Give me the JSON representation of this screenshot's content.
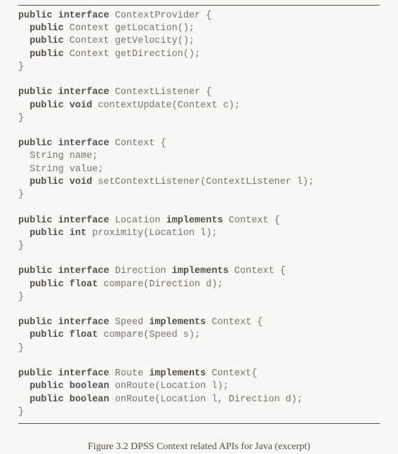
{
  "caption": "Figure 3.2 DPSS Context related APIs for Java (excerpt)",
  "code": {
    "lines": [
      [
        [
          "kw",
          "public"
        ],
        [
          "sp",
          " "
        ],
        [
          "kw",
          "interface"
        ],
        [
          "sp",
          " "
        ],
        [
          "id",
          "ContextProvider "
        ],
        [
          "pn",
          "{"
        ]
      ],
      [
        [
          "sp",
          "  "
        ],
        [
          "kw",
          "public"
        ],
        [
          "sp",
          " "
        ],
        [
          "id",
          "Context getLocation"
        ],
        [
          "pn",
          "();"
        ]
      ],
      [
        [
          "sp",
          "  "
        ],
        [
          "kw",
          "public"
        ],
        [
          "sp",
          " "
        ],
        [
          "id",
          "Context getVelocity"
        ],
        [
          "pn",
          "();"
        ]
      ],
      [
        [
          "sp",
          "  "
        ],
        [
          "kw",
          "public"
        ],
        [
          "sp",
          " "
        ],
        [
          "id",
          "Context getDirection"
        ],
        [
          "pn",
          "();"
        ]
      ],
      [
        [
          "pn",
          "}"
        ]
      ],
      "blank",
      [
        [
          "kw",
          "public"
        ],
        [
          "sp",
          " "
        ],
        [
          "kw",
          "interface"
        ],
        [
          "sp",
          " "
        ],
        [
          "id",
          "ContextListener "
        ],
        [
          "pn",
          "{"
        ]
      ],
      [
        [
          "sp",
          "  "
        ],
        [
          "kw",
          "public"
        ],
        [
          "sp",
          " "
        ],
        [
          "kw",
          "void"
        ],
        [
          "sp",
          " "
        ],
        [
          "id",
          "contextUpdate"
        ],
        [
          "pn",
          "("
        ],
        [
          "id",
          "Context c"
        ],
        [
          "pn",
          ");"
        ]
      ],
      [
        [
          "pn",
          "}"
        ]
      ],
      "blank",
      [
        [
          "kw",
          "public"
        ],
        [
          "sp",
          " "
        ],
        [
          "kw",
          "interface"
        ],
        [
          "sp",
          " "
        ],
        [
          "id",
          "Context "
        ],
        [
          "pn",
          "{"
        ]
      ],
      [
        [
          "sp",
          "  "
        ],
        [
          "id",
          "String name"
        ],
        [
          "pn",
          ";"
        ]
      ],
      [
        [
          "sp",
          "  "
        ],
        [
          "id",
          "String value"
        ],
        [
          "pn",
          ";"
        ]
      ],
      [
        [
          "sp",
          "  "
        ],
        [
          "kw",
          "public"
        ],
        [
          "sp",
          " "
        ],
        [
          "kw",
          "void"
        ],
        [
          "sp",
          " "
        ],
        [
          "id",
          "setContextListener"
        ],
        [
          "pn",
          "("
        ],
        [
          "id",
          "ContextListener l"
        ],
        [
          "pn",
          ");"
        ]
      ],
      [
        [
          "pn",
          "}"
        ]
      ],
      "blank",
      [
        [
          "kw",
          "public"
        ],
        [
          "sp",
          " "
        ],
        [
          "kw",
          "interface"
        ],
        [
          "sp",
          " "
        ],
        [
          "id",
          "Location "
        ],
        [
          "kw",
          "implements"
        ],
        [
          "sp",
          " "
        ],
        [
          "id",
          "Context "
        ],
        [
          "pn",
          "{"
        ]
      ],
      [
        [
          "sp",
          "  "
        ],
        [
          "kw",
          "public"
        ],
        [
          "sp",
          " "
        ],
        [
          "kw",
          "int"
        ],
        [
          "sp",
          " "
        ],
        [
          "id",
          "proximity"
        ],
        [
          "pn",
          "("
        ],
        [
          "id",
          "Location l"
        ],
        [
          "pn",
          ");"
        ]
      ],
      [
        [
          "pn",
          "}"
        ]
      ],
      "blank",
      [
        [
          "kw",
          "public"
        ],
        [
          "sp",
          " "
        ],
        [
          "kw",
          "interface"
        ],
        [
          "sp",
          " "
        ],
        [
          "id",
          "Direction "
        ],
        [
          "kw",
          "implements"
        ],
        [
          "sp",
          " "
        ],
        [
          "id",
          "Context "
        ],
        [
          "pn",
          "{"
        ]
      ],
      [
        [
          "sp",
          "  "
        ],
        [
          "kw",
          "public"
        ],
        [
          "sp",
          " "
        ],
        [
          "kw",
          "float"
        ],
        [
          "sp",
          " "
        ],
        [
          "id",
          "compare"
        ],
        [
          "pn",
          "("
        ],
        [
          "id",
          "Direction d"
        ],
        [
          "pn",
          ");"
        ]
      ],
      [
        [
          "pn",
          "}"
        ]
      ],
      "blank",
      [
        [
          "kw",
          "public"
        ],
        [
          "sp",
          " "
        ],
        [
          "kw",
          "interface"
        ],
        [
          "sp",
          " "
        ],
        [
          "id",
          "Speed "
        ],
        [
          "kw",
          "implements"
        ],
        [
          "sp",
          " "
        ],
        [
          "id",
          "Context "
        ],
        [
          "pn",
          "{"
        ]
      ],
      [
        [
          "sp",
          "  "
        ],
        [
          "kw",
          "public"
        ],
        [
          "sp",
          " "
        ],
        [
          "kw",
          "float"
        ],
        [
          "sp",
          " "
        ],
        [
          "id",
          "compare"
        ],
        [
          "pn",
          "("
        ],
        [
          "id",
          "Speed s"
        ],
        [
          "pn",
          ");"
        ]
      ],
      [
        [
          "pn",
          "}"
        ]
      ],
      "blank",
      [
        [
          "kw",
          "public"
        ],
        [
          "sp",
          " "
        ],
        [
          "kw",
          "interface"
        ],
        [
          "sp",
          " "
        ],
        [
          "id",
          "Route "
        ],
        [
          "kw",
          "implements"
        ],
        [
          "sp",
          " "
        ],
        [
          "id",
          "Context"
        ],
        [
          "pn",
          "{"
        ]
      ],
      [
        [
          "sp",
          "  "
        ],
        [
          "kw",
          "public"
        ],
        [
          "sp",
          " "
        ],
        [
          "kw",
          "boolean"
        ],
        [
          "sp",
          " "
        ],
        [
          "id",
          "onRoute"
        ],
        [
          "pn",
          "("
        ],
        [
          "id",
          "Location l"
        ],
        [
          "pn",
          ");"
        ]
      ],
      [
        [
          "sp",
          "  "
        ],
        [
          "kw",
          "public"
        ],
        [
          "sp",
          " "
        ],
        [
          "kw",
          "boolean"
        ],
        [
          "sp",
          " "
        ],
        [
          "id",
          "onRoute"
        ],
        [
          "pn",
          "("
        ],
        [
          "id",
          "Location l"
        ],
        [
          "pn",
          ", "
        ],
        [
          "id",
          "Direction d"
        ],
        [
          "pn",
          ");"
        ]
      ],
      [
        [
          "pn",
          "}"
        ]
      ]
    ]
  }
}
